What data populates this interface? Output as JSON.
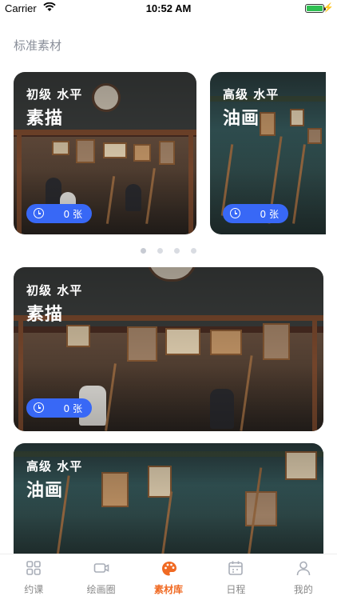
{
  "status_bar": {
    "carrier": "Carrier",
    "time": "10:52 AM"
  },
  "section_title": "标准素材",
  "carousel": [
    {
      "level": "初级 水平",
      "category": "素描",
      "count": "0 张"
    },
    {
      "level": "高级 水平",
      "category": "油画",
      "count": "0 张"
    }
  ],
  "list": [
    {
      "level": "初级 水平",
      "category": "素描",
      "count": "0 张"
    },
    {
      "level": "高级 水平",
      "category": "油画"
    }
  ],
  "tabs": [
    {
      "label": "约课",
      "icon": "grid-icon"
    },
    {
      "label": "绘画圈",
      "icon": "video-icon"
    },
    {
      "label": "素材库",
      "icon": "palette-icon",
      "active": true
    },
    {
      "label": "日程",
      "icon": "calendar-icon"
    },
    {
      "label": "我的",
      "icon": "person-icon"
    }
  ],
  "colors": {
    "accent": "#f06a23",
    "pill": "#3868f6",
    "battery": "#2fc052"
  }
}
